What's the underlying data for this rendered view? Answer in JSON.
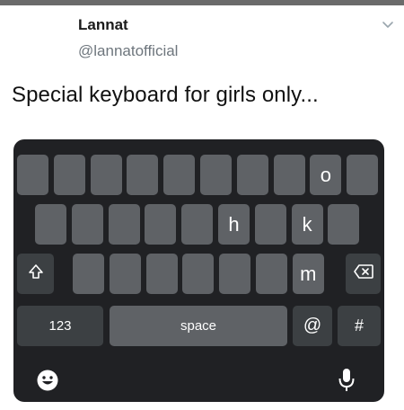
{
  "tweet": {
    "author_name": "Lannat",
    "author_handle": "@lannatofficial",
    "text": "Special keyboard for girls only..."
  },
  "keyboard": {
    "row1": [
      "",
      "",
      "",
      "",
      "",
      "",
      "",
      "",
      "o",
      ""
    ],
    "row2": [
      "",
      "",
      "",
      "",
      "",
      "h",
      "",
      "k",
      ""
    ],
    "row3": [
      "",
      "",
      "",
      "",
      "",
      "",
      "m"
    ],
    "shift_icon": "shift-icon",
    "backspace_icon": "backspace-icon",
    "numbers_label": "123",
    "space_label": "space",
    "at_label": "@",
    "hash_label": "#",
    "emoji_icon": "emoji-icon",
    "mic_icon": "microphone-icon",
    "colors": {
      "background": "#202124",
      "key": "#5f6266",
      "key_dark": "#3c4043"
    }
  }
}
